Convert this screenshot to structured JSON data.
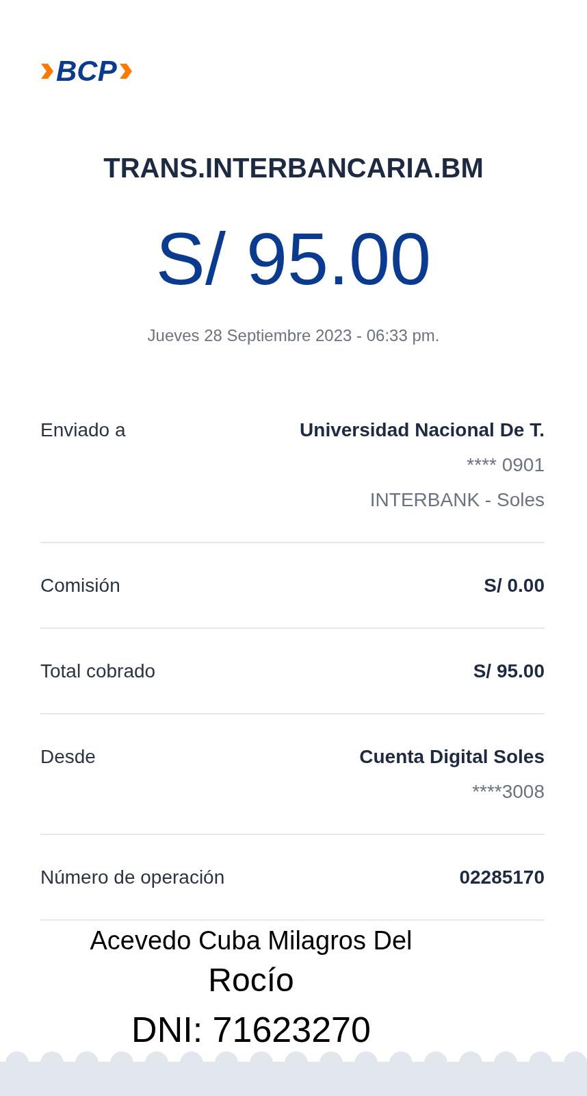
{
  "logo": {
    "text": "BCP"
  },
  "title": "TRANS.INTERBANCARIA.BM",
  "amount": "S/ 95.00",
  "date": "Jueves 28 Septiembre 2023 - 06:33 pm.",
  "rows": [
    {
      "label": "Enviado a",
      "values": [
        {
          "text": "Universidad Nacional De T.",
          "kind": "primary"
        },
        {
          "text": "**** 0901",
          "kind": "secondary"
        },
        {
          "text": "INTERBANK - Soles",
          "kind": "secondary"
        }
      ]
    },
    {
      "label": "Comisión",
      "values": [
        {
          "text": "S/ 0.00",
          "kind": "primary"
        }
      ]
    },
    {
      "label": "Total cobrado",
      "values": [
        {
          "text": "S/ 95.00",
          "kind": "primary"
        }
      ]
    },
    {
      "label": "Desde",
      "values": [
        {
          "text": "Cuenta Digital Soles",
          "kind": "primary"
        },
        {
          "text": "****3008",
          "kind": "secondary"
        }
      ]
    },
    {
      "label": "Número de operación",
      "values": [
        {
          "text": "02285170",
          "kind": "primary"
        }
      ]
    }
  ],
  "annotation": [
    "Acevedo Cuba Milagros Del",
    "Rocío",
    "DNI: 71623270"
  ]
}
